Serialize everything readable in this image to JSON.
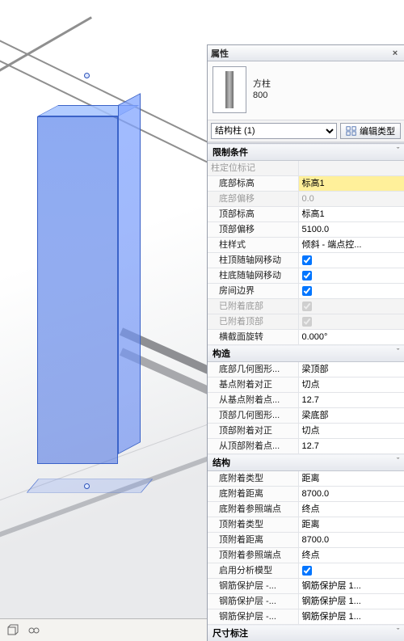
{
  "panel": {
    "title": "属性",
    "close_glyph": "×",
    "type": {
      "family": "方柱",
      "size": "800"
    },
    "selector": {
      "value": "结构柱 (1)"
    },
    "edit_type_label": "编辑类型"
  },
  "sections": [
    {
      "title": "限制条件",
      "rows": [
        {
          "label": "柱定位标记",
          "value": "",
          "readonly": true
        },
        {
          "label": "底部标高",
          "value": "标高1",
          "highlight": true,
          "indent": true
        },
        {
          "label": "底部偏移",
          "value": "0.0",
          "readonly": true,
          "indent": true
        },
        {
          "label": "顶部标高",
          "value": "标高1",
          "indent": true
        },
        {
          "label": "顶部偏移",
          "value": "5100.0",
          "indent": true
        },
        {
          "label": "柱样式",
          "value": "倾斜 - 端点控...",
          "indent": true
        },
        {
          "label": "柱顶随轴网移动",
          "type": "check",
          "checked": true,
          "indent": true
        },
        {
          "label": "柱底随轴网移动",
          "type": "check",
          "checked": true,
          "indent": true
        },
        {
          "label": "房间边界",
          "type": "check",
          "checked": true,
          "indent": true
        },
        {
          "label": "已附着底部",
          "type": "check",
          "checked": true,
          "readonly": true,
          "indent": true
        },
        {
          "label": "已附着顶部",
          "type": "check",
          "checked": true,
          "readonly": true,
          "indent": true
        },
        {
          "label": "横截面旋转",
          "value": "0.000°",
          "indent": true
        }
      ]
    },
    {
      "title": "构造",
      "rows": [
        {
          "label": "底部几何图形...",
          "value": "梁顶部",
          "indent": true
        },
        {
          "label": "基点附着对正",
          "value": "切点",
          "indent": true
        },
        {
          "label": "从基点附着点...",
          "value": "12.7",
          "indent": true
        },
        {
          "label": "顶部几何图形...",
          "value": "梁底部",
          "indent": true
        },
        {
          "label": "顶部附着对正",
          "value": "切点",
          "indent": true
        },
        {
          "label": "从顶部附着点...",
          "value": "12.7",
          "indent": true
        }
      ]
    },
    {
      "title": "结构",
      "rows": [
        {
          "label": "底附着类型",
          "value": "距离",
          "indent": true
        },
        {
          "label": "底附着距离",
          "value": "8700.0",
          "indent": true
        },
        {
          "label": "底附着参照端点",
          "value": "终点",
          "indent": true
        },
        {
          "label": "顶附着类型",
          "value": "距离",
          "indent": true
        },
        {
          "label": "顶附着距离",
          "value": "8700.0",
          "indent": true
        },
        {
          "label": "顶附着参照端点",
          "value": "终点",
          "indent": true
        },
        {
          "label": "启用分析模型",
          "type": "check",
          "checked": true,
          "indent": true
        },
        {
          "label": "钢筋保护层 -...",
          "value": "钢筋保护层 1...",
          "indent": true
        },
        {
          "label": "钢筋保护层 -...",
          "value": "钢筋保护层 1...",
          "indent": true
        },
        {
          "label": "钢筋保护层 -...",
          "value": "钢筋保护层 1...",
          "indent": true
        }
      ]
    },
    {
      "title": "尺寸标注",
      "rows": []
    }
  ]
}
